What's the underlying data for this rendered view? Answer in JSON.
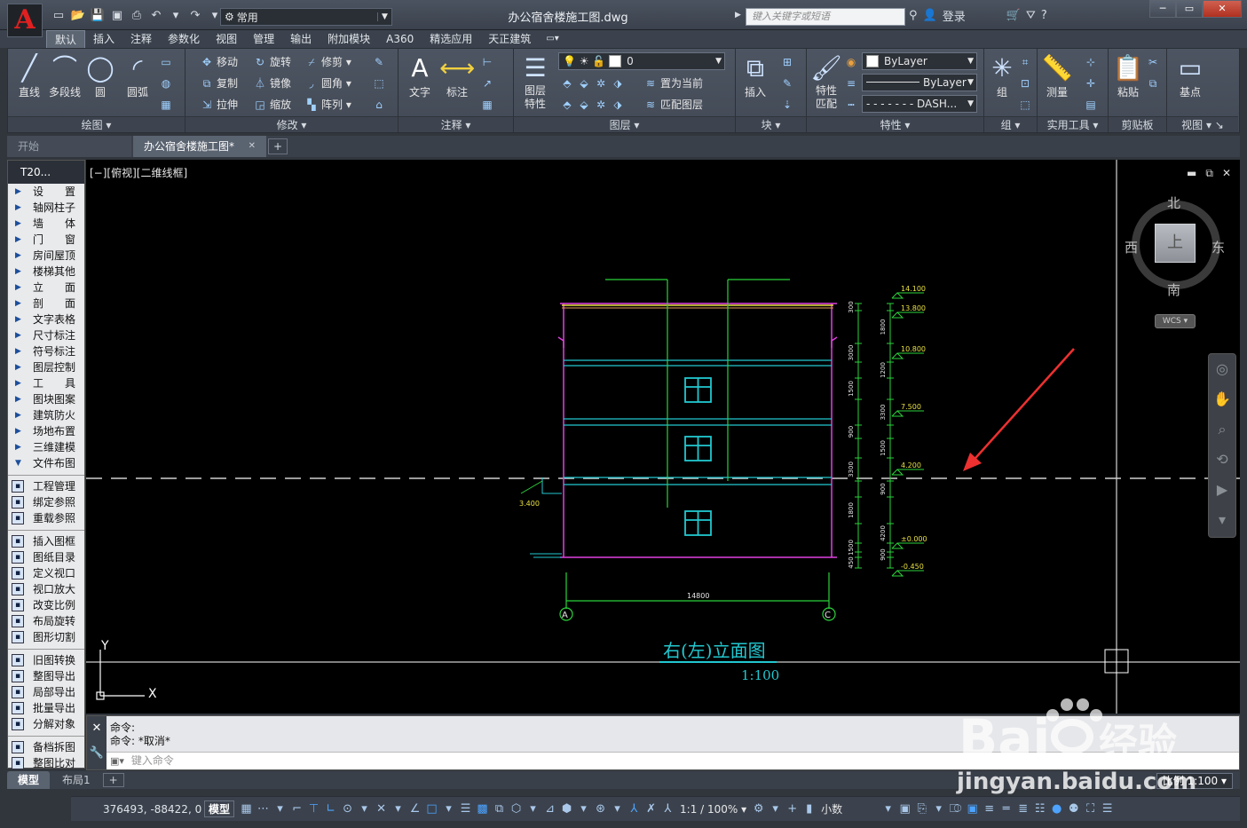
{
  "app": {
    "logo_letter": "A",
    "doc_title": "办公宿舍楼施工图.dwg",
    "workspace": "常用",
    "search_placeholder": "键入关键字或短语",
    "login": "登录"
  },
  "ribbon_tabs": [
    "默认",
    "插入",
    "注释",
    "参数化",
    "视图",
    "管理",
    "输出",
    "附加模块",
    "A360",
    "精选应用",
    "天正建筑"
  ],
  "ribbon": {
    "draw": {
      "title": "绘图",
      "line": "直线",
      "polyline": "多段线",
      "circle": "圆",
      "arc": "圆弧"
    },
    "modify": {
      "title": "修改",
      "move": "移动",
      "rotate": "旋转",
      "trim": "修剪",
      "copy": "复制",
      "mirror": "镜像",
      "fillet": "圆角",
      "stretch": "拉伸",
      "scale": "缩放",
      "array": "阵列"
    },
    "annotation": {
      "title": "注释",
      "text": "文字",
      "dimension": "标注"
    },
    "layers": {
      "title": "图层",
      "layer_props": "图层\n特性",
      "current_layer": "0",
      "set_current": "置为当前",
      "match_layer": "匹配图层"
    },
    "block": {
      "title": "块",
      "insert": "插入"
    },
    "properties": {
      "title": "特性",
      "match": "特性\n匹配",
      "color": "ByLayer",
      "linetype": "ByLayer",
      "linetype2": "DASH..."
    },
    "groups": {
      "title": "组",
      "group": "组"
    },
    "utilities": {
      "title": "实用工具",
      "measure": "测量"
    },
    "clipboard": {
      "title": "剪贴板",
      "paste": "粘贴"
    },
    "view": {
      "title": "视图",
      "base": "基点"
    }
  },
  "file_tabs": {
    "start": "开始",
    "active": "办公宿舍楼施工图*"
  },
  "palette": {
    "header": "T20...",
    "menu_items": [
      "设　　置",
      "轴网柱子",
      "墙　　体",
      "门　　窗",
      "房间屋顶",
      "楼梯其他",
      "立　　面",
      "剖　　面",
      "文字表格",
      "尺寸标注",
      "符号标注",
      "图层控制",
      "工　　具",
      "图块图案",
      "建筑防火",
      "场地布置",
      "三维建模",
      "文件布图"
    ],
    "group1": [
      "工程管理",
      "绑定参照",
      "重载参照"
    ],
    "group2": [
      "插入图框",
      "图纸目录",
      "定义视口",
      "视口放大",
      "改变比例",
      "布局旋转",
      "图形切割"
    ],
    "group3": [
      "旧图转换",
      "整图导出",
      "局部导出",
      "批量导出",
      "分解对象"
    ],
    "group4": [
      "备档拆图",
      "整图比对"
    ]
  },
  "viewport": {
    "label": "[−][俯视][二维线框]",
    "viewcube": {
      "north": "北",
      "south": "南",
      "east": "东",
      "west": "西",
      "face": "上",
      "wcs": "WCS"
    }
  },
  "drawing": {
    "title": "右(左)立面图",
    "scale": "1:100",
    "width_dim": "14800",
    "axis_left": "A",
    "axis_right": "C",
    "elevations": [
      "14.100",
      "13.800",
      "10.800",
      "7.500",
      "4.200",
      "±0.000",
      "-0.450"
    ],
    "step_elevation": "3.400",
    "dims": [
      "300",
      "1800",
      "3000",
      "1200",
      "1500",
      "3300",
      "900",
      "1500",
      "3300",
      "900",
      "1800",
      "4200",
      "1500",
      "900",
      "450"
    ],
    "ucs_x": "X",
    "ucs_y": "Y"
  },
  "command": {
    "history1": "命令:",
    "history2": "命令: *取消*",
    "placeholder": "键入命令"
  },
  "layout_tabs": {
    "model": "模型",
    "layout1": "布局1",
    "scale": "比例 1:100"
  },
  "status": {
    "coords": "376493, -88422, 0",
    "model": "模型",
    "annoscale": "1:1 / 100%",
    "units": "小数"
  },
  "watermark": {
    "url": "jingyan.baidu.com"
  },
  "colors": {
    "magenta": "#e040e0",
    "cyan": "#22c8d0",
    "green": "#2bd23b",
    "yellow": "#e8e040",
    "arrow_red": "#ee3030"
  }
}
